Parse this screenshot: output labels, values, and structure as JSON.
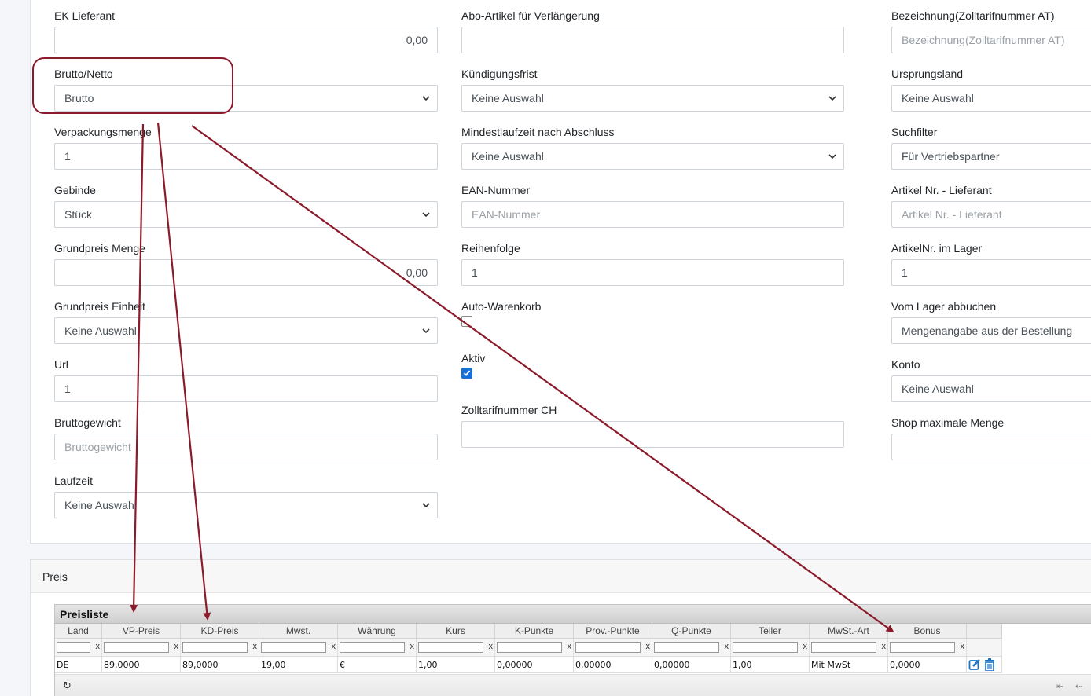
{
  "form": {
    "col1": [
      {
        "label": "EK Lieferant",
        "value": "0,00",
        "align": "right",
        "type": "text"
      },
      {
        "label": "Brutto/Netto",
        "value": "Brutto",
        "type": "select"
      },
      {
        "label": "Verpackungsmenge",
        "value": "1",
        "type": "text"
      },
      {
        "label": "Gebinde",
        "value": "Stück",
        "type": "select"
      },
      {
        "label": "Grundpreis Menge",
        "value": "0,00",
        "align": "right",
        "type": "text"
      },
      {
        "label": "Grundpreis Einheit",
        "value": "Keine Auswahl",
        "type": "select"
      },
      {
        "label": "Url",
        "value": "1",
        "type": "text"
      },
      {
        "label": "Bruttogewicht",
        "placeholder": "Bruttogewicht",
        "type": "text"
      },
      {
        "label": "Laufzeit",
        "value": "Keine Auswahl",
        "type": "select"
      }
    ],
    "col2": [
      {
        "label": "Abo-Artikel für Verlängerung",
        "value": "",
        "type": "text"
      },
      {
        "label": "Kündigungsfrist",
        "value": "Keine Auswahl",
        "type": "select"
      },
      {
        "label": "Mindestlaufzeit nach Abschluss",
        "value": "Keine Auswahl",
        "type": "select"
      },
      {
        "label": "EAN-Nummer",
        "placeholder": "EAN-Nummer",
        "type": "text"
      },
      {
        "label": "Reihenfolge",
        "value": "1",
        "type": "text"
      },
      {
        "label": "Auto-Warenkorb",
        "checked": false,
        "type": "checkbox"
      },
      {
        "label": "Aktiv",
        "checked": true,
        "type": "checkbox"
      },
      {
        "label": "Zolltarifnummer CH",
        "value": "",
        "type": "text"
      }
    ],
    "col3": [
      {
        "label": "Bezeichnung(Zolltarifnummer AT)",
        "placeholder": "Bezeichnung(Zolltarifnummer AT)",
        "type": "text"
      },
      {
        "label": "Ursprungsland",
        "value": "Keine Auswahl",
        "type": "text"
      },
      {
        "label": "Suchfilter",
        "value": "Für Vertriebspartner",
        "type": "text"
      },
      {
        "label": "Artikel Nr. - Lieferant",
        "placeholder": "Artikel Nr. - Lieferant",
        "type": "text"
      },
      {
        "label": "ArtikelNr. im Lager",
        "value": "1",
        "type": "text"
      },
      {
        "label": "Vom Lager abbuchen",
        "value": "Mengenangabe aus der Bestellung",
        "type": "text"
      },
      {
        "label": "Konto",
        "value": "Keine Auswahl",
        "type": "text"
      },
      {
        "label": "Shop maximale Menge",
        "value": "",
        "type": "text"
      }
    ]
  },
  "preis_section": {
    "title": "Preis"
  },
  "grid": {
    "caption": "Preisliste",
    "columns": [
      "Land",
      "VP-Preis",
      "KD-Preis",
      "Mwst.",
      "Währung",
      "Kurs",
      "K-Punkte",
      "Prov.-Punkte",
      "Q-Punkte",
      "Teiler",
      "MwSt.-Art",
      "Bonus",
      ""
    ],
    "clear_symbol": "x",
    "rows": [
      [
        "DE",
        "89,0000",
        "89,0000",
        "19,00",
        "€",
        "1,00",
        "0,00000",
        "0,00000",
        "0,00000",
        "1,00",
        "Mit MwSt",
        "0,0000",
        ""
      ]
    ],
    "icons": [
      "edit-icon",
      "delete-icon",
      "refresh-icon",
      "first-page-icon",
      "prev-page-icon"
    ]
  },
  "annotation": {
    "highlight_color": "#8b1a2b"
  },
  "colors": {
    "accent": "#1a6fd6",
    "annotation": "#8b1a2b"
  }
}
